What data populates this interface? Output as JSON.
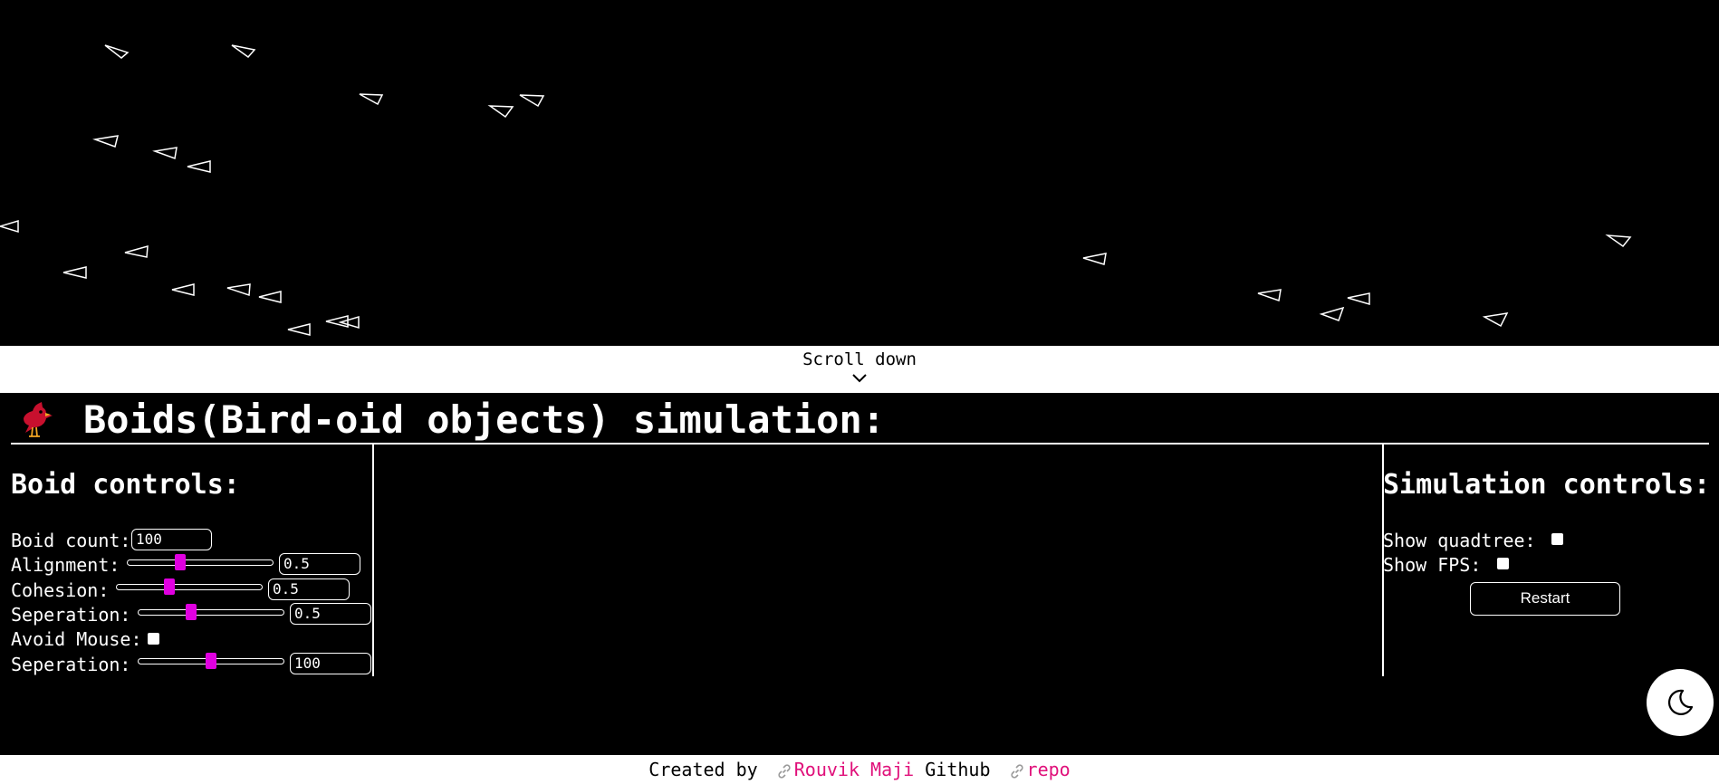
{
  "scroll": {
    "label": "Scroll down",
    "icon": "chevron-down-icon"
  },
  "header": {
    "title": "Boids(Bird-oid objects) simulation:",
    "icon": "bird-icon",
    "icon_color": "#c8102e"
  },
  "boid_controls": {
    "title": "Boid controls:",
    "boid_count": {
      "label": "Boid count:",
      "value": "100"
    },
    "alignment": {
      "label": "Alignment:",
      "value": "0.5",
      "slider": 0.35
    },
    "cohesion": {
      "label": "Cohesion:",
      "value": "0.5",
      "slider": 0.35
    },
    "separation": {
      "label": "Seperation:",
      "value": "0.5",
      "slider": 0.35
    },
    "avoid_mouse": {
      "label": "Avoid Mouse:",
      "checked": false
    },
    "separation_distance": {
      "label": "Seperation:",
      "value": "100",
      "slider": 0.5
    }
  },
  "simulation_controls": {
    "title": "Simulation controls:",
    "show_quadtree": {
      "label": "Show quadtree:",
      "checked": false
    },
    "show_fps": {
      "label": "Show FPS:",
      "checked": false
    },
    "restart_label": "Restart"
  },
  "theme_toggle": {
    "icon": "moon-icon"
  },
  "footer": {
    "created_by": "Created by",
    "author_link": "Rouvik Maji",
    "github": "Github",
    "repo_link": "repo",
    "link_icon": "link-icon",
    "link_color": "#e0107a"
  },
  "colors": {
    "background": "#000000",
    "slider_thumb": "#e000e0",
    "boid_stroke": "#ffffff"
  }
}
